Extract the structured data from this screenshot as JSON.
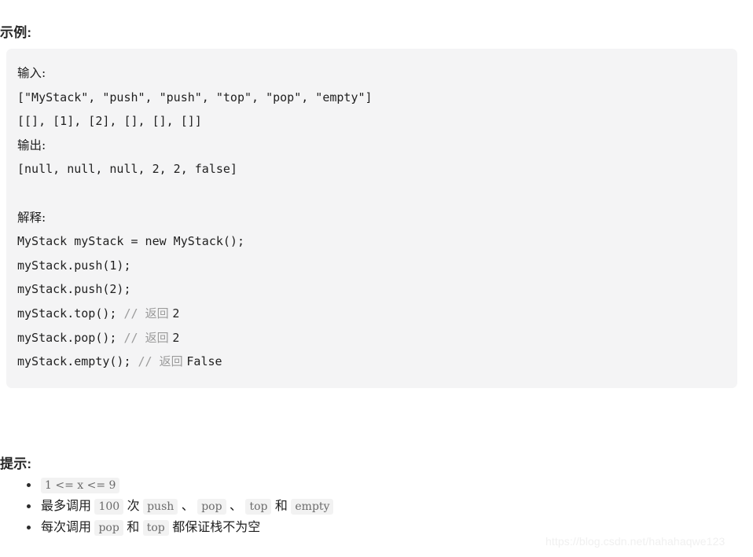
{
  "sections": {
    "example_heading": "示例:",
    "hints_heading": "提示:"
  },
  "example_block": {
    "background_color": "#f4f4f5",
    "lines": [
      {
        "kind": "cjk",
        "text": "输入:"
      },
      {
        "kind": "code",
        "text": "[\"MyStack\", \"push\", \"push\", \"top\", \"pop\", \"empty\"]"
      },
      {
        "kind": "code",
        "text": "[[], [1], [2], [], [], []]"
      },
      {
        "kind": "cjk",
        "text": "输出:"
      },
      {
        "kind": "code",
        "text": "[null, null, null, 2, 2, false]"
      },
      {
        "kind": "blank",
        "text": ""
      },
      {
        "kind": "cjk",
        "text": "解释:"
      },
      {
        "kind": "code",
        "text": "MyStack myStack = new MyStack();"
      },
      {
        "kind": "code",
        "text": "myStack.push(1);"
      },
      {
        "kind": "code",
        "text": "myStack.push(2);"
      },
      {
        "kind": "code_comment",
        "code": "myStack.top(); ",
        "slashes": "// ",
        "comment_cjk": "返回 ",
        "comment_value": "2"
      },
      {
        "kind": "code_comment",
        "code": "myStack.pop(); ",
        "slashes": "// ",
        "comment_cjk": "返回 ",
        "comment_value": "2"
      },
      {
        "kind": "code_comment",
        "code": "myStack.empty(); ",
        "slashes": "// ",
        "comment_cjk": "返回 ",
        "comment_value": "False"
      }
    ]
  },
  "hints": [
    {
      "parts": [
        {
          "type": "chip",
          "text": "1 <= x <= 9"
        }
      ]
    },
    {
      "parts": [
        {
          "type": "text",
          "text": "最多调用 "
        },
        {
          "type": "chip",
          "text": "100"
        },
        {
          "type": "text",
          "text": " 次 "
        },
        {
          "type": "chip",
          "text": "push"
        },
        {
          "type": "text",
          "text": " 、 "
        },
        {
          "type": "chip",
          "text": "pop"
        },
        {
          "type": "text",
          "text": " 、 "
        },
        {
          "type": "chip",
          "text": "top"
        },
        {
          "type": "text",
          "text": " 和 "
        },
        {
          "type": "chip",
          "text": "empty"
        }
      ]
    },
    {
      "parts": [
        {
          "type": "text",
          "text": "每次调用 "
        },
        {
          "type": "chip",
          "text": "pop"
        },
        {
          "type": "text",
          "text": " 和 "
        },
        {
          "type": "chip",
          "text": "top"
        },
        {
          "type": "text",
          "text": " 都保证栈不为空"
        }
      ]
    }
  ],
  "watermark": {
    "text": "https://blog.csdn.net/hahahaqwe123"
  }
}
